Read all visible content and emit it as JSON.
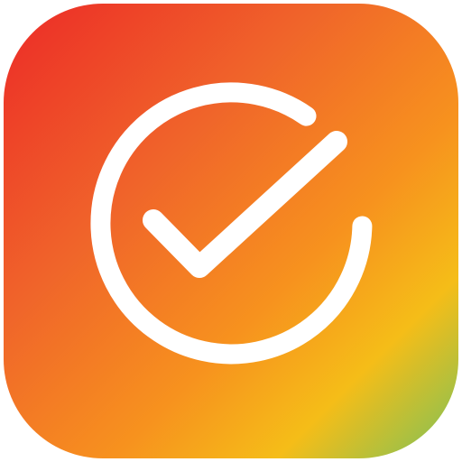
{
  "app_icon": {
    "name": "checkmark-circle-app-icon",
    "colors": {
      "gradient_start": "#EC2A27",
      "gradient_mid_1": "#F0652A",
      "gradient_mid_2": "#F7921E",
      "gradient_mid_3": "#F5BD18",
      "gradient_end": "#7CC25A",
      "glyph": "#FFFFFF"
    }
  }
}
